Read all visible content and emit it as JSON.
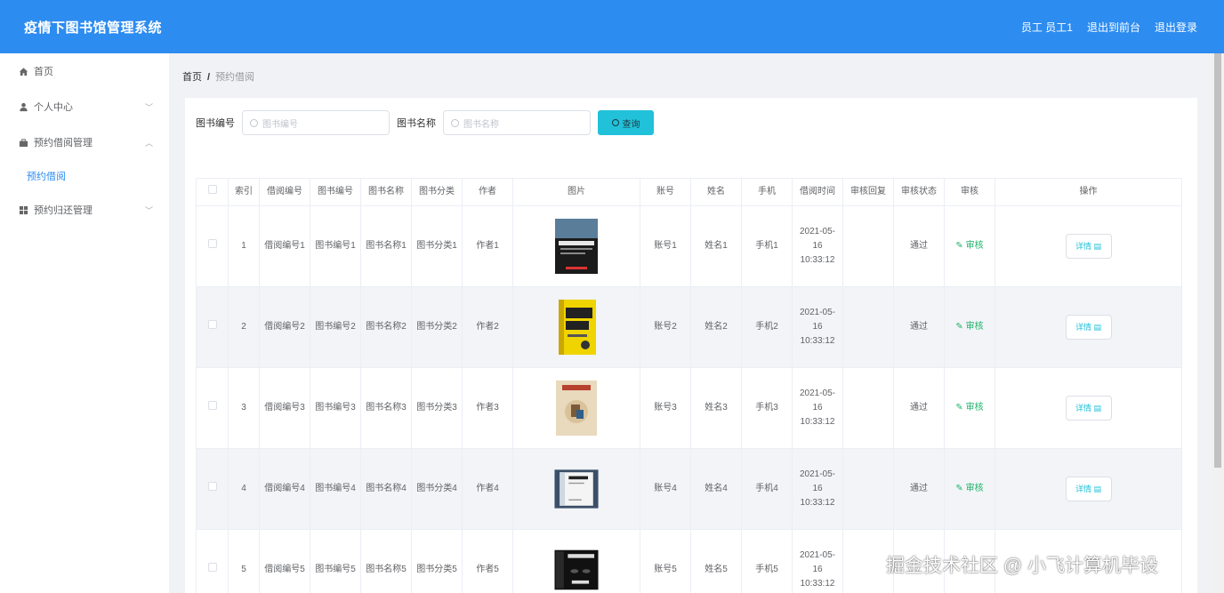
{
  "app_title": "疫情下图书馆管理系统",
  "header": {
    "user": "员工 员工1",
    "to_front": "退出到前台",
    "logout": "退出登录"
  },
  "sidebar": {
    "items": [
      {
        "label": "首页",
        "icon": "home-icon"
      },
      {
        "label": "个人中心",
        "icon": "user-icon"
      },
      {
        "label": "预约借阅管理",
        "icon": "briefcase-icon"
      },
      {
        "label": "预约归还管理",
        "icon": "grid-icon"
      }
    ],
    "sub_item": "预约借阅"
  },
  "breadcrumb": {
    "home": "首页",
    "sep": "/",
    "current": "预约借阅"
  },
  "search": {
    "label1": "图书编号",
    "placeholder1": "图书编号",
    "label2": "图书名称",
    "placeholder2": "图书名称",
    "button": "查询"
  },
  "table": {
    "headers": [
      "索引",
      "借阅编号",
      "图书编号",
      "图书名称",
      "图书分类",
      "作者",
      "图片",
      "账号",
      "姓名",
      "手机",
      "借阅时间",
      "审核回复",
      "审核状态",
      "审核",
      "操作"
    ],
    "audit_label": "审核",
    "detail_label": "详情",
    "rows": [
      {
        "index": "1",
        "borrow_no": "借阅编号1",
        "book_no": "图书编号1",
        "book_name": "图书名称1",
        "category": "图书分类1",
        "author": "作者1",
        "account": "账号1",
        "name": "姓名1",
        "phone": "手机1",
        "time": "2021-05-16 10:33:12",
        "reply": "",
        "status": "通过"
      },
      {
        "index": "2",
        "borrow_no": "借阅编号2",
        "book_no": "图书编号2",
        "book_name": "图书名称2",
        "category": "图书分类2",
        "author": "作者2",
        "account": "账号2",
        "name": "姓名2",
        "phone": "手机2",
        "time": "2021-05-16 10:33:12",
        "reply": "",
        "status": "通过"
      },
      {
        "index": "3",
        "borrow_no": "借阅编号3",
        "book_no": "图书编号3",
        "book_name": "图书名称3",
        "category": "图书分类3",
        "author": "作者3",
        "account": "账号3",
        "name": "姓名3",
        "phone": "手机3",
        "time": "2021-05-16 10:33:12",
        "reply": "",
        "status": "通过"
      },
      {
        "index": "4",
        "borrow_no": "借阅编号4",
        "book_no": "图书编号4",
        "book_name": "图书名称4",
        "category": "图书分类4",
        "author": "作者4",
        "account": "账号4",
        "name": "姓名4",
        "phone": "手机4",
        "time": "2021-05-16 10:33:12",
        "reply": "",
        "status": "通过"
      },
      {
        "index": "5",
        "borrow_no": "借阅编号5",
        "book_no": "图书编号5",
        "book_name": "图书名称5",
        "category": "图书分类5",
        "author": "作者5",
        "account": "账号5",
        "name": "姓名5",
        "phone": "手机5",
        "time": "2021-05-16 10:33:12",
        "reply": "",
        "status": ""
      }
    ]
  },
  "watermark": "掘金技术社区 @ 小飞计算机毕设",
  "colors": {
    "header": "#2d8cf0",
    "accent": "#20c1d9",
    "audit": "#20b26b"
  }
}
